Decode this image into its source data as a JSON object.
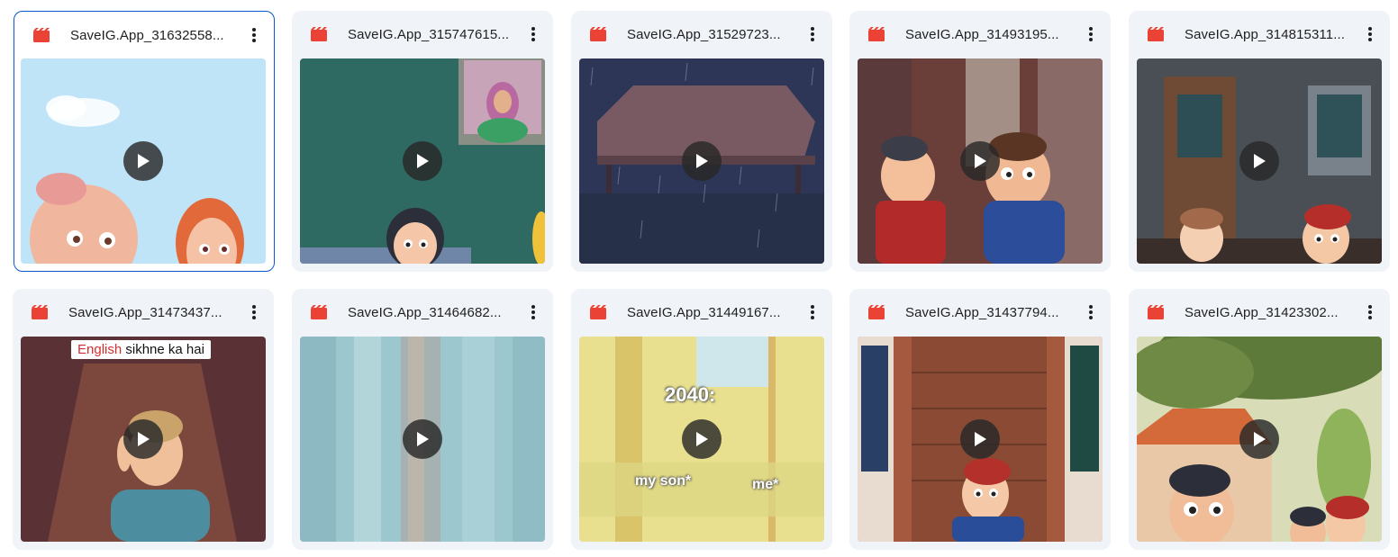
{
  "colors": {
    "accent": "#0b57d0",
    "card_bg": "#f0f4f9",
    "video_icon": "#ea4335"
  },
  "files": [
    {
      "name": "SaveIG.App_31632558...",
      "type_icon": "video-file-icon",
      "selected": true
    },
    {
      "name": "SaveIG.App_315747615...",
      "type_icon": "video-file-icon",
      "selected": false
    },
    {
      "name": "SaveIG.App_31529723...",
      "type_icon": "video-file-icon",
      "selected": false
    },
    {
      "name": "SaveIG.App_31493195...",
      "type_icon": "video-file-icon",
      "selected": false
    },
    {
      "name": "SaveIG.App_314815311...",
      "type_icon": "video-file-icon",
      "selected": false
    },
    {
      "name": "SaveIG.App_31473437...",
      "type_icon": "video-file-icon",
      "selected": false,
      "overlay_a": "English",
      "overlay_b": "sikhne ka hai"
    },
    {
      "name": "SaveIG.App_31464682...",
      "type_icon": "video-file-icon",
      "selected": false
    },
    {
      "name": "SaveIG.App_31449167...",
      "type_icon": "video-file-icon",
      "selected": false,
      "overlay_year": "2040:",
      "overlay_son": "my son*",
      "overlay_me": "me*"
    },
    {
      "name": "SaveIG.App_31437794...",
      "type_icon": "video-file-icon",
      "selected": false
    },
    {
      "name": "SaveIG.App_31423302...",
      "type_icon": "video-file-icon",
      "selected": false
    }
  ]
}
